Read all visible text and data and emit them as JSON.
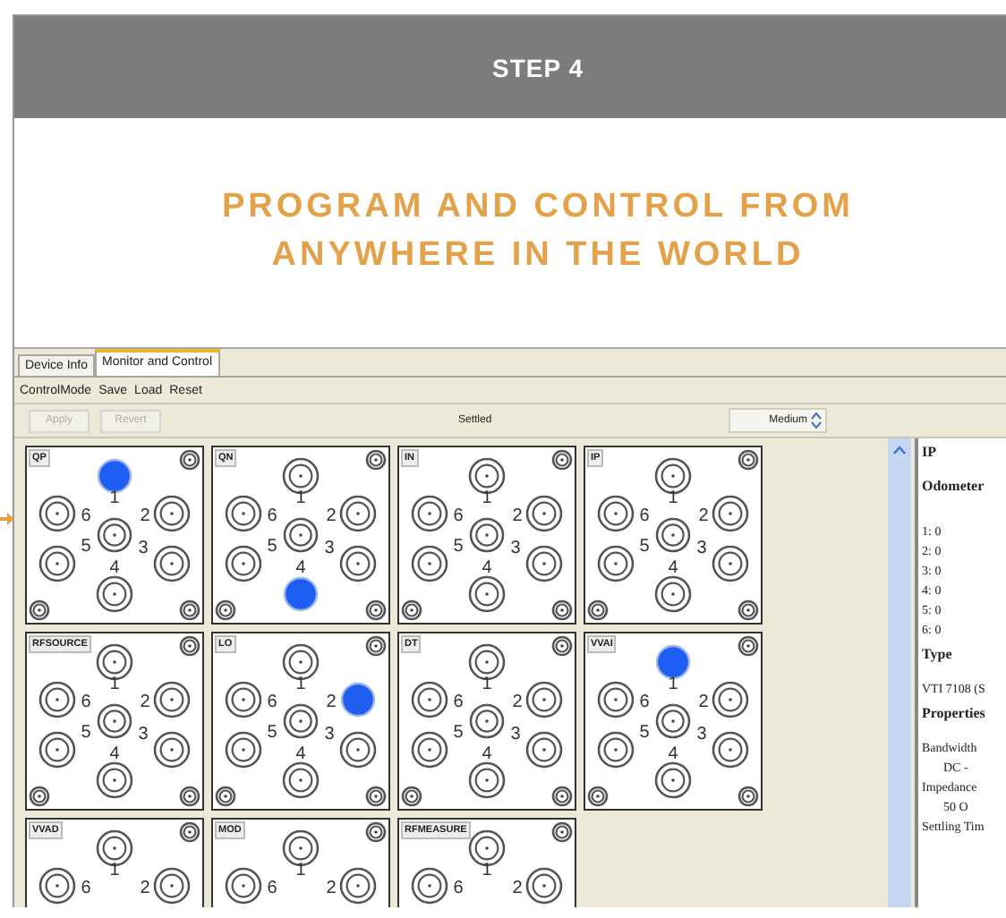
{
  "header": {
    "step": "STEP 4"
  },
  "headline": [
    "PROGRAM AND CONTROL FROM",
    "ANYWHERE IN THE WORLD"
  ],
  "app": {
    "tabs": [
      {
        "label": "Device Info",
        "selected": false
      },
      {
        "label": "Monitor and Control",
        "selected": true
      }
    ],
    "menu": [
      "ControlMode",
      "Save",
      "Load",
      "Reset"
    ],
    "toolbar": {
      "buttons": [
        {
          "label": "Apply",
          "disabled": true
        },
        {
          "label": "Revert",
          "disabled": true
        }
      ],
      "status": "Settled",
      "speed": "Medium"
    },
    "switches": [
      {
        "name": "QP",
        "ports": [
          {
            "label": "1",
            "selected": true
          },
          {
            "label": "2",
            "selected": false
          },
          {
            "label": "3",
            "selected": false
          },
          {
            "label": "4",
            "selected": false
          },
          {
            "label": "5",
            "selected": false
          },
          {
            "label": "6",
            "selected": false
          }
        ]
      },
      {
        "name": "QN",
        "ports": [
          {
            "label": "1",
            "selected": false
          },
          {
            "label": "2",
            "selected": false
          },
          {
            "label": "3",
            "selected": false
          },
          {
            "label": "4",
            "selected": true
          },
          {
            "label": "5",
            "selected": false
          },
          {
            "label": "6",
            "selected": false
          }
        ]
      },
      {
        "name": "IN",
        "ports": [
          {
            "label": "1",
            "selected": false
          },
          {
            "label": "2",
            "selected": false
          },
          {
            "label": "3",
            "selected": false
          },
          {
            "label": "4",
            "selected": false
          },
          {
            "label": "5",
            "selected": false
          },
          {
            "label": "6",
            "selected": false
          }
        ]
      },
      {
        "name": "IP",
        "ports": [
          {
            "label": "1",
            "selected": false
          },
          {
            "label": "2",
            "selected": false
          },
          {
            "label": "3",
            "selected": false
          },
          {
            "label": "4",
            "selected": false
          },
          {
            "label": "5",
            "selected": false
          },
          {
            "label": "6",
            "selected": false
          }
        ]
      },
      {
        "name": "RFSOURCE",
        "ports": [
          {
            "label": "1",
            "selected": false
          },
          {
            "label": "2",
            "selected": false
          },
          {
            "label": "3",
            "selected": false
          },
          {
            "label": "4",
            "selected": false
          },
          {
            "label": "5",
            "selected": false
          },
          {
            "label": "6",
            "selected": false
          }
        ]
      },
      {
        "name": "LO",
        "ports": [
          {
            "label": "1",
            "selected": false
          },
          {
            "label": "2",
            "selected": true
          },
          {
            "label": "3",
            "selected": false
          },
          {
            "label": "4",
            "selected": false
          },
          {
            "label": "5",
            "selected": false
          },
          {
            "label": "6",
            "selected": false
          }
        ]
      },
      {
        "name": "DT",
        "ports": [
          {
            "label": "1",
            "selected": false
          },
          {
            "label": "2",
            "selected": false
          },
          {
            "label": "3",
            "selected": false
          },
          {
            "label": "4",
            "selected": false
          },
          {
            "label": "5",
            "selected": false
          },
          {
            "label": "6",
            "selected": false
          }
        ]
      },
      {
        "name": "VVAI",
        "ports": [
          {
            "label": "1",
            "selected": true
          },
          {
            "label": "2",
            "selected": false
          },
          {
            "label": "3",
            "selected": false
          },
          {
            "label": "4",
            "selected": false
          },
          {
            "label": "5",
            "selected": false
          },
          {
            "label": "6",
            "selected": false
          }
        ]
      },
      {
        "name": "VVAD",
        "ports": [
          {
            "kind": "top",
            "label": "1",
            "selected": false
          },
          {
            "kind": "right",
            "label": "2",
            "selected": false
          },
          {
            "kind": "left",
            "label": "6",
            "selected": false
          }
        ]
      },
      {
        "name": "MOD",
        "ports": [
          {
            "kind": "top",
            "label": "1",
            "selected": false
          },
          {
            "kind": "right",
            "label": "2",
            "selected": false
          },
          {
            "kind": "left",
            "label": "6",
            "selected": false
          }
        ]
      },
      {
        "name": "RFMEASURE",
        "ports": [
          {
            "kind": "top",
            "label": "1",
            "selected": false
          },
          {
            "kind": "right",
            "label": "2",
            "selected": false
          },
          {
            "kind": "left",
            "label": "6",
            "selected": false
          }
        ]
      }
    ],
    "properties_panel": [
      {
        "kind": "heading",
        "text": "IP"
      },
      {
        "kind": "heading",
        "text": "Odometer"
      },
      {
        "kind": "gap"
      },
      {
        "kind": "line",
        "text": "1: 0"
      },
      {
        "kind": "line",
        "text": "2: 0"
      },
      {
        "kind": "line",
        "text": "3: 0"
      },
      {
        "kind": "line",
        "text": "4: 0"
      },
      {
        "kind": "line",
        "text": "5: 0"
      },
      {
        "kind": "line",
        "text": "6: 0"
      },
      {
        "kind": "heading",
        "text": "Type"
      },
      {
        "kind": "line",
        "text": "VTI 7108 (S"
      },
      {
        "kind": "heading",
        "text": "Properties"
      },
      {
        "kind": "line",
        "text": "Bandwidth"
      },
      {
        "kind": "value",
        "text": "DC -"
      },
      {
        "kind": "line",
        "text": "Impedance"
      },
      {
        "kind": "value",
        "text": "50 O"
      },
      {
        "kind": "line",
        "text": "Settling Tim"
      }
    ]
  }
}
